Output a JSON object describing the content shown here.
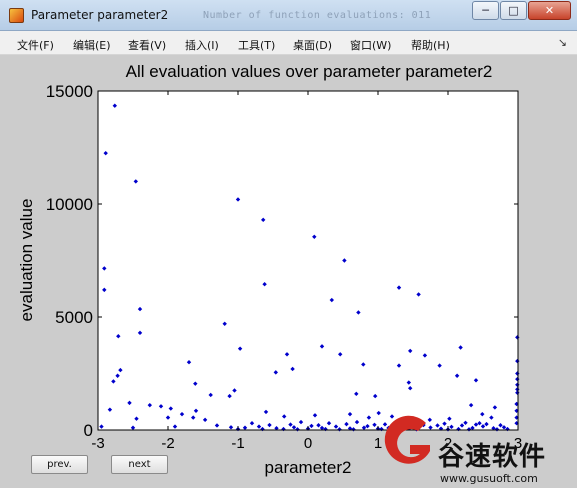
{
  "window": {
    "title": "Parameter parameter2",
    "background_title": "Number of function evaluations: 011",
    "controls": [
      "─",
      "□",
      "✕"
    ]
  },
  "menu": {
    "items": [
      "文件(F)",
      "编辑(E)",
      "查看(V)",
      "插入(I)",
      "工具(T)",
      "桌面(D)",
      "窗口(W)",
      "帮助(H)"
    ],
    "dock_icon": "↘"
  },
  "buttons": {
    "prev": "prev.",
    "next": "next"
  },
  "watermark": {
    "name": "谷速软件",
    "url": "www.gusuoft.com"
  },
  "colors": {
    "marker": "#0000cc",
    "axes_bg": "#ffffff",
    "figure_bg": "#cccccc"
  },
  "chart_data": {
    "type": "scatter",
    "title": "All evaluation values over parameter parameter2",
    "xlabel": "parameter2",
    "ylabel": "evaluation value",
    "xlim": [
      -3,
      3
    ],
    "ylim": [
      0,
      15000
    ],
    "xticks": [
      "-3",
      "-2",
      "-1",
      "0",
      "1",
      "2",
      "3"
    ],
    "yticks": [
      "0",
      "5000",
      "10000",
      "15000"
    ],
    "grid": false,
    "marker": "filled-diamond",
    "points": [
      [
        -2.89,
        12250
      ],
      [
        -2.76,
        14350
      ],
      [
        -2.46,
        11000
      ],
      [
        -2.91,
        7150
      ],
      [
        -2.91,
        6200
      ],
      [
        -2.4,
        5350
      ],
      [
        -2.4,
        4300
      ],
      [
        -2.71,
        4150
      ],
      [
        -2.68,
        2650
      ],
      [
        -2.72,
        2400
      ],
      [
        -2.78,
        2150
      ],
      [
        -2.55,
        1200
      ],
      [
        -2.83,
        900
      ],
      [
        -2.26,
        1100
      ],
      [
        -2.1,
        1050
      ],
      [
        -1.96,
        950
      ],
      [
        -2.45,
        500
      ],
      [
        -2.0,
        550
      ],
      [
        -1.7,
        3000
      ],
      [
        -1.61,
        2050
      ],
      [
        -1.8,
        700
      ],
      [
        -1.64,
        550
      ],
      [
        -1.0,
        10200
      ],
      [
        -0.64,
        9300
      ],
      [
        -0.97,
        3600
      ],
      [
        -1.19,
        4700
      ],
      [
        -0.62,
        6450
      ],
      [
        -0.3,
        3350
      ],
      [
        0.09,
        8550
      ],
      [
        0.52,
        7500
      ],
      [
        0.34,
        5750
      ],
      [
        0.72,
        5200
      ],
      [
        0.2,
        3700
      ],
      [
        -0.46,
        2550
      ],
      [
        -0.22,
        2700
      ],
      [
        0.46,
        3350
      ],
      [
        0.79,
        2900
      ],
      [
        0.69,
        1600
      ],
      [
        1.3,
        6300
      ],
      [
        1.58,
        6000
      ],
      [
        1.88,
        2850
      ],
      [
        1.3,
        2850
      ],
      [
        2.18,
        3650
      ],
      [
        1.46,
        3500
      ],
      [
        1.67,
        3300
      ],
      [
        2.13,
        2400
      ],
      [
        2.4,
        2200
      ],
      [
        1.44,
        2100
      ],
      [
        1.46,
        1850
      ],
      [
        0.96,
        1500
      ],
      [
        2.33,
        1100
      ],
      [
        2.67,
        1000
      ],
      [
        2.99,
        4100
      ],
      [
        2.99,
        3050
      ],
      [
        2.99,
        2500
      ],
      [
        2.99,
        2250
      ],
      [
        2.99,
        2000
      ],
      [
        2.99,
        1800
      ],
      [
        2.99,
        1650
      ],
      [
        2.98,
        1150
      ],
      [
        2.98,
        850
      ],
      [
        2.98,
        550
      ],
      [
        2.98,
        300
      ],
      [
        -1.39,
        1550
      ],
      [
        -1.12,
        1500
      ],
      [
        -1.05,
        1750
      ],
      [
        -1.47,
        450
      ],
      [
        -1.6,
        850
      ],
      [
        -0.6,
        800
      ],
      [
        -0.34,
        600
      ],
      [
        0.1,
        650
      ],
      [
        0.6,
        700
      ],
      [
        1.01,
        750
      ],
      [
        1.2,
        600
      ],
      [
        1.74,
        450
      ],
      [
        2.02,
        500
      ],
      [
        2.49,
        700
      ],
      [
        2.62,
        550
      ],
      [
        0.87,
        550
      ],
      [
        1.6,
        400
      ],
      [
        -2.95,
        150
      ],
      [
        -2.5,
        100
      ],
      [
        -1.9,
        150
      ],
      [
        -1.3,
        200
      ],
      [
        -0.9,
        100
      ],
      [
        -0.7,
        150
      ],
      [
        -0.45,
        80
      ],
      [
        -0.2,
        120
      ],
      [
        0.0,
        60
      ],
      [
        0.2,
        90
      ],
      [
        0.4,
        150
      ],
      [
        0.6,
        70
      ],
      [
        0.8,
        100
      ],
      [
        1.0,
        60
      ],
      [
        1.15,
        90
      ],
      [
        1.3,
        130
      ],
      [
        1.45,
        80
      ],
      [
        1.6,
        160
      ],
      [
        1.75,
        110
      ],
      [
        1.9,
        60
      ],
      [
        2.05,
        140
      ],
      [
        2.2,
        200
      ],
      [
        2.35,
        90
      ],
      [
        2.5,
        160
      ],
      [
        2.65,
        80
      ],
      [
        2.8,
        120
      ],
      [
        -0.8,
        300
      ],
      [
        -0.1,
        350
      ],
      [
        0.3,
        300
      ],
      [
        0.7,
        350
      ],
      [
        1.1,
        250
      ],
      [
        1.4,
        300
      ],
      [
        1.95,
        280
      ],
      [
        2.25,
        320
      ],
      [
        2.55,
        260
      ],
      [
        -0.55,
        220
      ],
      [
        -0.25,
        240
      ],
      [
        0.15,
        210
      ],
      [
        0.55,
        260
      ],
      [
        0.95,
        230
      ],
      [
        1.35,
        210
      ],
      [
        1.85,
        200
      ],
      [
        2.4,
        240
      ],
      [
        2.75,
        210
      ],
      [
        -1.1,
        120
      ],
      [
        -0.35,
        40
      ],
      [
        0.05,
        180
      ],
      [
        0.45,
        30
      ],
      [
        0.85,
        170
      ],
      [
        1.25,
        40
      ],
      [
        1.65,
        220
      ],
      [
        2.15,
        40
      ],
      [
        2.45,
        300
      ],
      [
        2.85,
        40
      ],
      [
        -0.65,
        40
      ],
      [
        -0.15,
        30
      ],
      [
        0.25,
        40
      ],
      [
        0.65,
        30
      ],
      [
        1.05,
        40
      ],
      [
        1.55,
        30
      ],
      [
        2.0,
        30
      ],
      [
        2.3,
        30
      ],
      [
        2.7,
        30
      ],
      [
        -1.0,
        40
      ]
    ]
  }
}
